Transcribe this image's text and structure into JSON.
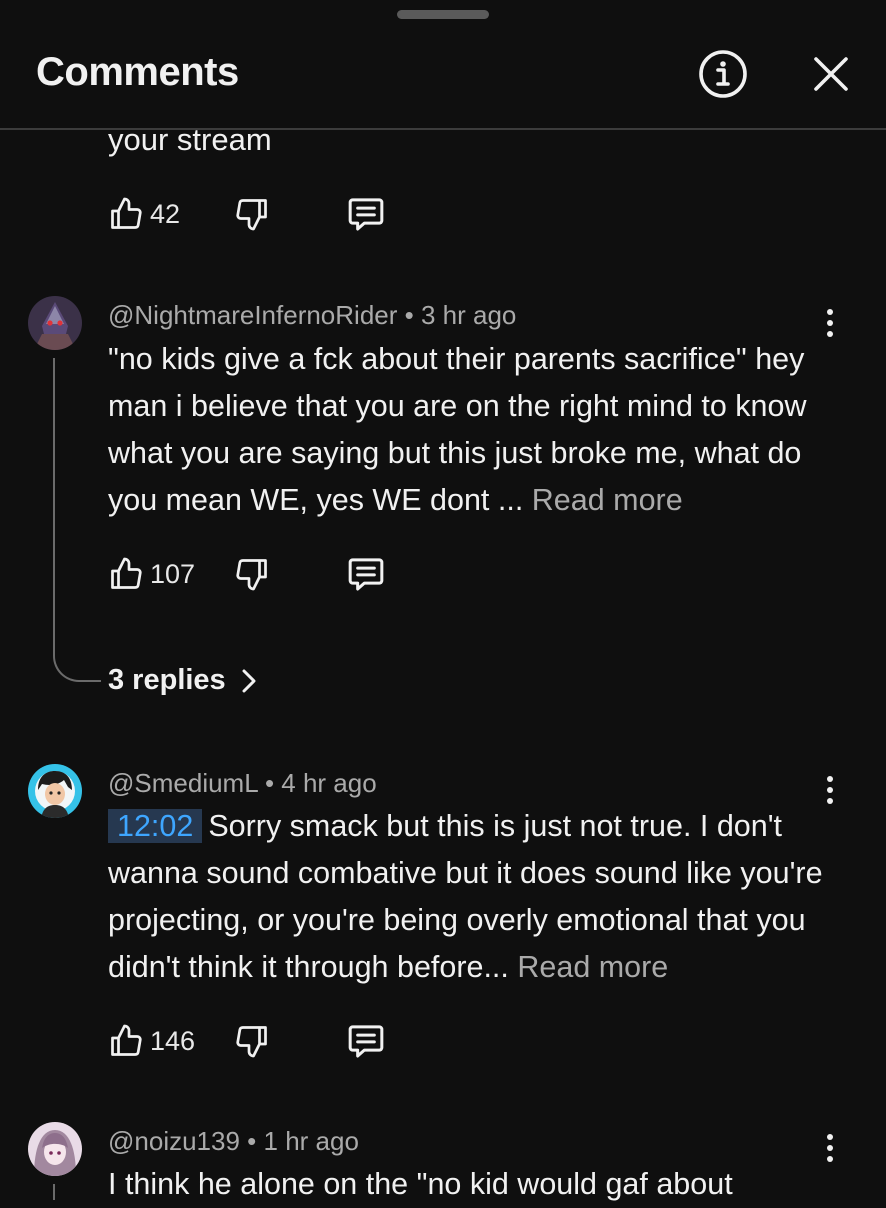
{
  "header": {
    "title": "Comments",
    "info_icon": "info-icon",
    "close_icon": "close-icon"
  },
  "previous_comment": {
    "text_tail": "your stream",
    "likes": "42"
  },
  "comments": [
    {
      "author": "@NightmareInfernoRider",
      "separator": "•",
      "time": "3 hr ago",
      "text": "\"no kids give a fck about their parents sacrifice\" hey man i believe that you are on the right mind to know what you are saying but this just broke me, what do you mean WE, yes WE dont ...",
      "read_more": "Read more",
      "likes": "107",
      "replies_label": "3 replies"
    },
    {
      "author": "@SmediumL",
      "separator": "•",
      "time": "4 hr ago",
      "timestamp": "12:02",
      "text": "Sorry smack but this is just not true. I don't wanna sound combative but it does sound like you're projecting, or you're being overly emotional that you didn't think it through before...",
      "read_more": "Read more",
      "likes": "146"
    },
    {
      "author": "@noizu139",
      "separator": "•",
      "time": "1 hr ago",
      "text": "I think he alone on the \"no kid would gaf about"
    }
  ],
  "colors": {
    "background": "#0f0f0f",
    "text_primary": "#f1f1f1",
    "text_secondary": "#aaaaaa",
    "timestamp_link": "#3ea6ff",
    "timestamp_bg": "#263850",
    "divider": "#3c3c3c"
  }
}
